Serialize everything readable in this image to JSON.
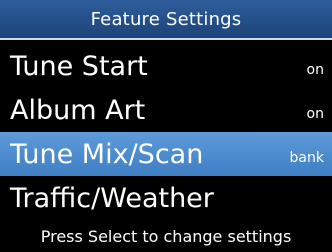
{
  "header": {
    "title": "Feature Settings"
  },
  "menu": {
    "items": [
      {
        "label": "Tune Start",
        "value": "on",
        "selected": false
      },
      {
        "label": "Album Art",
        "value": "on",
        "selected": false
      },
      {
        "label": "Tune Mix/Scan",
        "value": "bank",
        "selected": true
      },
      {
        "label": "Traffic/Weather",
        "value": "",
        "selected": false
      }
    ]
  },
  "footer": {
    "hint": "Press Select to change settings"
  },
  "colors": {
    "header_background": "#2a5692",
    "selected_background": "#4a89cc",
    "screen_background": "#000000",
    "text": "#ffffff"
  }
}
